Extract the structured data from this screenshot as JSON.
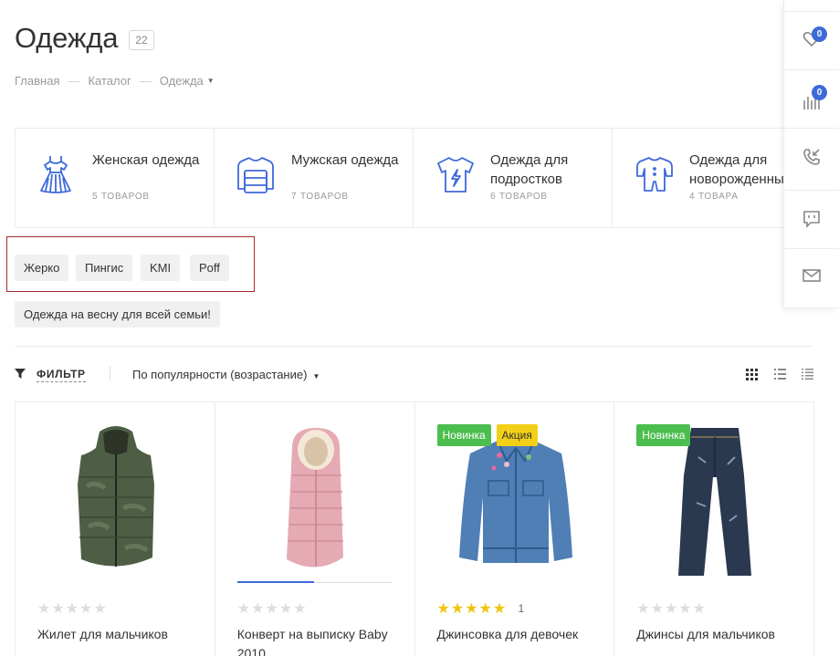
{
  "header": {
    "title": "Одежда",
    "count": "22"
  },
  "breadcrumb": {
    "home": "Главная",
    "catalog": "Каталог",
    "current": "Одежда"
  },
  "categories": [
    {
      "name": "Женская одежда",
      "count": "5 товаров",
      "icon": "dress-icon"
    },
    {
      "name": "Мужская одежда",
      "count": "7 товаров",
      "icon": "sweater-icon"
    },
    {
      "name": "Одежда для подростков",
      "count": "6 товаров",
      "icon": "tshirt-icon"
    },
    {
      "name": "Одежда для новорожденных",
      "count": "4 товара",
      "icon": "onesie-icon"
    }
  ],
  "brands": [
    "Жерко",
    "Пингис",
    "KMI",
    "Poff"
  ],
  "promo_tag": "Одежда на весну для всей семьи!",
  "toolbar": {
    "filter_label": "ФИЛЬТР",
    "sort_label": "По популярности (возрастание)"
  },
  "products": [
    {
      "name": "Жилет для мальчиков",
      "rating": "★★★★★",
      "rating_value": 0,
      "reviews": "",
      "badges": []
    },
    {
      "name": "Конверт на выписку Baby 2010",
      "rating": "★★★★★",
      "rating_value": 0,
      "reviews": "",
      "badges": []
    },
    {
      "name": "Джинсовка для девочек",
      "rating": "★★★★★",
      "rating_value": 5,
      "reviews": "1",
      "badges": [
        "Новинка",
        "Акция"
      ]
    },
    {
      "name": "Джинсы для мальчиков",
      "rating": "★★★★★",
      "rating_value": 0,
      "reviews": "",
      "badges": [
        "Новинка"
      ]
    }
  ],
  "side_panel": {
    "favorites_count": "0",
    "compare_count": "0"
  },
  "colors": {
    "accent": "#3e6ad8",
    "new_badge": "#4cbe4f",
    "sale_badge": "#f2d018",
    "star_on": "#f1c40f",
    "highlight_border": "#a52a2a"
  }
}
